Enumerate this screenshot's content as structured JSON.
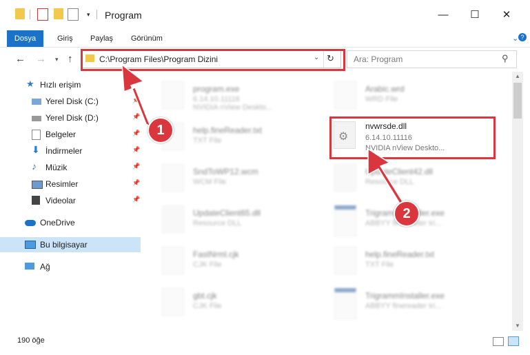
{
  "window": {
    "title": "Program"
  },
  "window_controls": {
    "minimize": "—",
    "maximize": "☐",
    "close": "✕"
  },
  "ribbon": {
    "tabs": [
      "Dosya",
      "Giriş",
      "Paylaş",
      "Görünüm"
    ]
  },
  "address_bar": {
    "path": "C:\\Program Files\\Program Dizini"
  },
  "search": {
    "placeholder": "Ara: Program"
  },
  "sidebar": {
    "items": [
      {
        "label": "Hızlı erişim"
      },
      {
        "label": "Yerel Disk (C:)"
      },
      {
        "label": "Yerel Disk (D:)"
      },
      {
        "label": "Belgeler"
      },
      {
        "label": "İndirmeler"
      },
      {
        "label": "Müzik"
      },
      {
        "label": "Resimler"
      },
      {
        "label": "Videolar"
      },
      {
        "label": "OneDrive"
      },
      {
        "label": "Bu bilgisayar"
      },
      {
        "label": "Ağ"
      }
    ]
  },
  "files": [
    {
      "name": "program.exe",
      "line1": "6.14.10.11116",
      "line2": "NVIDIA nView Deskto..."
    },
    {
      "name": "Arabic.wrd",
      "line1": "WRD File",
      "line2": ""
    },
    {
      "name": "help.fineReader.txt",
      "line1": "TXT File",
      "line2": ""
    },
    {
      "name": "nvwrsde.dll",
      "line1": "6.14.10.11116",
      "line2": "NVIDIA nView Deskto..."
    },
    {
      "name": "SndToWP12.wcm",
      "line1": "WCM File",
      "line2": ""
    },
    {
      "name": "UpdateClient42.dll",
      "line1": "Resource DLL",
      "line2": ""
    },
    {
      "name": "UpdateClient65.dll",
      "line1": "Resource DLL",
      "line2": ""
    },
    {
      "name": "TrigrammInstaller.exe",
      "line1": "ABBYY finereader tri...",
      "line2": ""
    },
    {
      "name": "FastNrml.cjk",
      "line1": "CJK File",
      "line2": ""
    },
    {
      "name": "help.fineReader.txt",
      "line1": "TXT File",
      "line2": ""
    },
    {
      "name": "gbt.cjk",
      "line1": "CJK File",
      "line2": ""
    },
    {
      "name": "TrigrammInstaller.exe",
      "line1": "ABBYY finereader tri...",
      "line2": ""
    }
  ],
  "status": {
    "count": "190 öğe"
  },
  "annotations": {
    "badge1": "1",
    "badge2": "2"
  },
  "colors": {
    "accent": "#1a73c8",
    "highlight": "#d9363e"
  }
}
